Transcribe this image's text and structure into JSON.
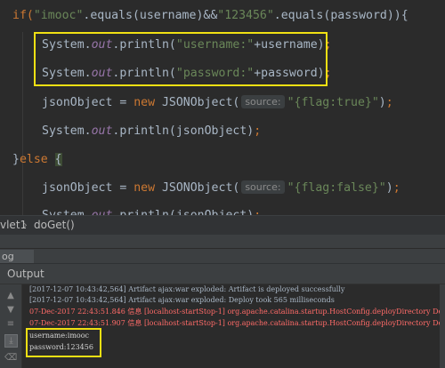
{
  "editor": {
    "lines": [
      {
        "segments": [
          {
            "t": "if(",
            "c": "kw"
          },
          {
            "t": "\"imooc\"",
            "c": "str"
          },
          {
            "t": ".equals(username)&&",
            "c": ""
          },
          {
            "t": "\"123456\"",
            "c": "str"
          },
          {
            "t": ".equals(password)){",
            "c": ""
          }
        ]
      },
      {
        "segments": [
          {
            "t": "System.",
            "c": ""
          },
          {
            "t": "out",
            "c": "fld"
          },
          {
            "t": ".println(",
            "c": ""
          },
          {
            "t": "\"username:\"",
            "c": "str"
          },
          {
            "t": "+username)",
            "c": ""
          },
          {
            "t": ";",
            "c": "kw"
          }
        ]
      },
      {
        "segments": [
          {
            "t": "System.",
            "c": ""
          },
          {
            "t": "out",
            "c": "fld"
          },
          {
            "t": ".println(",
            "c": ""
          },
          {
            "t": "\"password:\"",
            "c": "str"
          },
          {
            "t": "+password)",
            "c": ""
          },
          {
            "t": ";",
            "c": "kw"
          }
        ]
      },
      {
        "segments": [
          {
            "t": "jsonObject = ",
            "c": ""
          },
          {
            "t": "new ",
            "c": "kw"
          },
          {
            "t": "JSONObject(",
            "c": ""
          },
          {
            "t": "source:",
            "c": "hint"
          },
          {
            "t": "\"{flag:true}\"",
            "c": "str"
          },
          {
            "t": ")",
            "c": ""
          },
          {
            "t": ";",
            "c": "kw"
          }
        ]
      },
      {
        "segments": [
          {
            "t": "System.",
            "c": ""
          },
          {
            "t": "out",
            "c": "fld"
          },
          {
            "t": ".println(jsonObject)",
            "c": ""
          },
          {
            "t": ";",
            "c": "kw"
          }
        ]
      },
      {
        "segments": [
          {
            "t": "}",
            "c": ""
          },
          {
            "t": "else ",
            "c": "kw"
          },
          {
            "t": "{",
            "c": "brace-hl"
          }
        ]
      },
      {
        "segments": [
          {
            "t": "jsonObject = ",
            "c": ""
          },
          {
            "t": "new ",
            "c": "kw"
          },
          {
            "t": "JSONObject(",
            "c": ""
          },
          {
            "t": "source:",
            "c": "hint"
          },
          {
            "t": "\"{flag:false}\"",
            "c": "str"
          },
          {
            "t": ")",
            "c": ""
          },
          {
            "t": ";",
            "c": "kw"
          }
        ]
      },
      {
        "segments": [
          {
            "t": "System.",
            "c": ""
          },
          {
            "t": "out",
            "c": "fld"
          },
          {
            "t": ".println(jsonObject)",
            "c": ""
          },
          {
            "t": ";",
            "c": "kw"
          }
        ]
      }
    ]
  },
  "breadcrumb": {
    "item1": "vlet1",
    "separator": "›",
    "item2": "doGet()"
  },
  "tool_strip": {
    "tab_label": "og"
  },
  "output_panel": {
    "title": "Output"
  },
  "log": {
    "lines": [
      {
        "text": "[2017-12-07 10:43:42,564] Artifact ajax:war exploded: Artifact is deployed successfully",
        "kind": "info"
      },
      {
        "text": "[2017-12-07 10:43:42,564] Artifact ajax:war exploded: Deploy took 565 milliseconds",
        "kind": "info"
      },
      {
        "text": "07-Dec-2017 22:43:51.846 信息 [localhost-startStop-1] org.apache.catalina.startup.HostConfig.deployDirectory Dep",
        "kind": "err"
      },
      {
        "text": "07-Dec-2017 22:43:51.907 信息 [localhost-startStop-1] org.apache.catalina.startup.HostConfig.deployDirectory Dep",
        "kind": "err"
      },
      {
        "text": "username:imooc",
        "kind": "out"
      },
      {
        "text": "password:123456",
        "kind": "out"
      }
    ]
  },
  "colors": {
    "highlight_box": "#f0e013",
    "keyword": "#cc7832",
    "string": "#6a8759",
    "error_log": "#ff6b68"
  }
}
